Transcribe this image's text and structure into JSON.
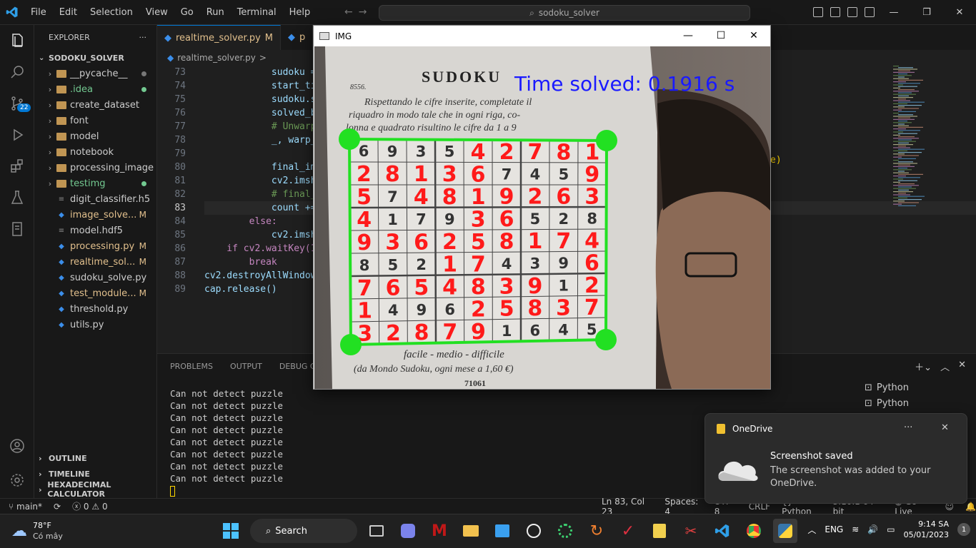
{
  "titlebar": {
    "menu": [
      "File",
      "Edit",
      "Selection",
      "View",
      "Go",
      "Run",
      "Terminal",
      "Help"
    ],
    "search": "sodoku_solver"
  },
  "activity": {
    "source_control_badge": "22"
  },
  "explorer": {
    "title": "EXPLORER",
    "folder": "SODOKU_SOLVER",
    "items": [
      {
        "name": "__pycache__",
        "type": "folder",
        "color": "#cccccc",
        "status": "dot"
      },
      {
        "name": ".idea",
        "type": "folder",
        "color": "#73c991",
        "status": "dot"
      },
      {
        "name": "create_dataset",
        "type": "folder",
        "color": "#cccccc",
        "status": ""
      },
      {
        "name": "font",
        "type": "folder",
        "color": "#cccccc",
        "status": ""
      },
      {
        "name": "model",
        "type": "folder",
        "color": "#cccccc",
        "status": ""
      },
      {
        "name": "notebook",
        "type": "folder",
        "color": "#cccccc",
        "status": ""
      },
      {
        "name": "processing_image",
        "type": "folder",
        "color": "#cccccc",
        "status": ""
      },
      {
        "name": "testimg",
        "type": "folder",
        "color": "#73c991",
        "status": "dot"
      },
      {
        "name": "digit_classifier.h5",
        "type": "file",
        "color": "#cccccc",
        "status": ""
      },
      {
        "name": "image_solve...",
        "type": "py",
        "color": "#e2c08d",
        "status": "M"
      },
      {
        "name": "model.hdf5",
        "type": "file",
        "color": "#cccccc",
        "status": ""
      },
      {
        "name": "processing.py",
        "type": "py",
        "color": "#e2c08d",
        "status": "M"
      },
      {
        "name": "realtime_sol...",
        "type": "py",
        "color": "#e2c08d",
        "status": "M"
      },
      {
        "name": "sudoku_solve.py",
        "type": "py",
        "color": "#cccccc",
        "status": ""
      },
      {
        "name": "test_module...",
        "type": "py",
        "color": "#e2c08d",
        "status": "M"
      },
      {
        "name": "threshold.py",
        "type": "py",
        "color": "#cccccc",
        "status": ""
      },
      {
        "name": "utils.py",
        "type": "py",
        "color": "#cccccc",
        "status": ""
      }
    ],
    "outline": "OUTLINE",
    "timeline": "TIMELINE",
    "hexcalc": "HEXADECIMAL CALCULATOR"
  },
  "editor": {
    "tabs": [
      {
        "label": "realtime_solver.py",
        "mod": "M"
      },
      {
        "label": "p",
        "mod": ""
      }
    ],
    "breadcrumb": [
      "realtime_solver.py",
      ">"
    ],
    "lines": [
      {
        "n": "73",
        "text": "            sudoku ="
      },
      {
        "n": "74",
        "text": "            start_ti"
      },
      {
        "n": "75",
        "text": "            sudoku.s"
      },
      {
        "n": "76",
        "text": "            solved_b"
      },
      {
        "n": "77",
        "text": "            # Unwarp"
      },
      {
        "n": "78",
        "text": "            _, warp_"
      },
      {
        "n": "79",
        "text": ""
      },
      {
        "n": "80",
        "text": "            final_im"
      },
      {
        "n": "81",
        "text": "            cv2.imsh"
      },
      {
        "n": "82",
        "text": "            # final_"
      },
      {
        "n": "83",
        "text": "            count +="
      },
      {
        "n": "84",
        "text": "        else:"
      },
      {
        "n": "85",
        "text": "            cv2.imsh"
      },
      {
        "n": "86",
        "text": "    if cv2.waitKey(1"
      },
      {
        "n": "87",
        "text": "        break"
      },
      {
        "n": "88",
        "text": "cv2.destroyAllWindow"
      },
      {
        "n": "89",
        "text": "cap.release()"
      }
    ],
    "right_fragment": "e)"
  },
  "panel": {
    "tabs": [
      "PROBLEMS",
      "OUTPUT",
      "DEBUG CON"
    ],
    "terminal_lines": [
      "Can not detect puzzle",
      "Can not detect puzzle",
      "Can not detect puzzle",
      "Can not detect puzzle",
      "Can not detect puzzle",
      "Can not detect puzzle",
      "Can not detect puzzle",
      "Can not detect puzzle"
    ],
    "terminals": [
      "Python",
      "Python"
    ]
  },
  "statusbar": {
    "branch": "main*",
    "errors": "0",
    "warnings": "0",
    "position": "Ln 83, Col 23",
    "spaces": "Spaces: 4",
    "encoding": "UTF-8",
    "eol": "CRLF",
    "language": "Python",
    "interpreter": "3.10.1 64-bit",
    "golive": "Go Live"
  },
  "cvwindow": {
    "title": "IMG",
    "time_text": "Time solved: 0.1916 s",
    "book_title": "SUDOKU",
    "book_number": "8556.",
    "instructions": [
      "Rispettando le cifre inserite, completate il",
      "riquadro in modo tale che in ogni riga, co-",
      "lonna e quadrato risultino le cifre da 1 a 9"
    ],
    "footer1": "facile - medio - difficile",
    "footer2": "(da Mondo Sudoku, ogni mese a 1,60 €)",
    "footer3": "71061",
    "grid": [
      [
        "6",
        "9",
        "3",
        "5",
        "4",
        "2",
        "7",
        "8",
        "1"
      ],
      [
        "2",
        "8",
        "1",
        "3",
        "6",
        "7",
        "4",
        "5",
        "9"
      ],
      [
        "5",
        "7",
        "4",
        "8",
        "1",
        "9",
        "2",
        "6",
        "3"
      ],
      [
        "4",
        "1",
        "7",
        "9",
        "3",
        "6",
        "5",
        "2",
        "8"
      ],
      [
        "9",
        "3",
        "6",
        "2",
        "5",
        "8",
        "1",
        "7",
        "4"
      ],
      [
        "8",
        "5",
        "2",
        "1",
        "7",
        "4",
        "3",
        "9",
        "6"
      ],
      [
        "7",
        "6",
        "5",
        "4",
        "8",
        "3",
        "9",
        "1",
        "2"
      ],
      [
        "1",
        "4",
        "9",
        "6",
        "2",
        "5",
        "8",
        "3",
        "7"
      ],
      [
        "3",
        "2",
        "8",
        "7",
        "9",
        "1",
        "6",
        "4",
        "5"
      ]
    ],
    "solved_mask": [
      [
        0,
        0,
        0,
        0,
        1,
        1,
        1,
        1,
        1
      ],
      [
        1,
        1,
        1,
        1,
        1,
        0,
        0,
        0,
        1
      ],
      [
        1,
        0,
        1,
        1,
        1,
        1,
        1,
        1,
        1
      ],
      [
        1,
        0,
        0,
        0,
        1,
        1,
        0,
        0,
        0
      ],
      [
        1,
        1,
        1,
        1,
        1,
        1,
        1,
        1,
        1
      ],
      [
        0,
        0,
        0,
        1,
        1,
        0,
        0,
        0,
        1
      ],
      [
        1,
        1,
        1,
        1,
        1,
        1,
        1,
        0,
        1
      ],
      [
        1,
        0,
        0,
        0,
        1,
        1,
        1,
        1,
        1
      ],
      [
        1,
        1,
        1,
        1,
        1,
        0,
        0,
        0,
        0
      ]
    ]
  },
  "toast": {
    "app": "OneDrive",
    "title": "Screenshot saved",
    "body": "The screenshot was added to your OneDrive."
  },
  "taskbar": {
    "temp": "78°F",
    "weather": "Có mây",
    "search": "Search",
    "lang": "ENG",
    "time": "9:14 SA",
    "date": "05/01/2023",
    "notif": "1"
  },
  "colors": {
    "accent": "#0078d4",
    "solved_digit": "#ff1a1a",
    "corner": "#22e022",
    "time_text": "#1a1aff"
  }
}
